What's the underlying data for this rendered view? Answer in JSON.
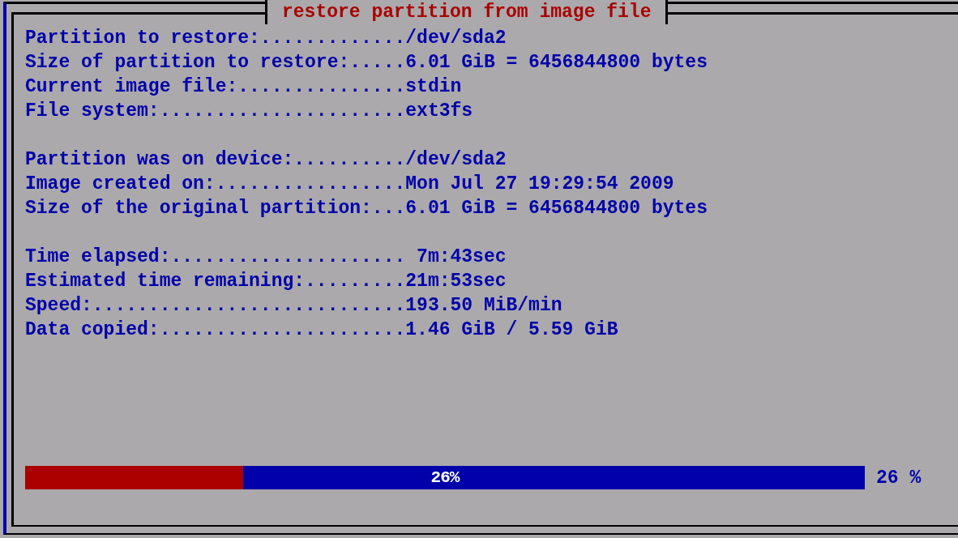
{
  "window": {
    "title": "restore partition from image file"
  },
  "sections": [
    {
      "lines": [
        "Partition to restore:............./dev/sda2",
        "Size of partition to restore:.....6.01 GiB = 6456844800 bytes",
        "Current image file:...............stdin",
        "File system:......................ext3fs"
      ]
    },
    {
      "lines": [
        "Partition was on device:........../dev/sda2",
        "Image created on:.................Mon Jul 27 19:29:54 2009",
        "Size of the original partition:...6.01 GiB = 6456844800 bytes"
      ]
    },
    {
      "lines": [
        "Time elapsed:..................... 7m:43sec",
        "Estimated time remaining:.........21m:53sec",
        "Speed:............................193.50 MiB/min",
        "Data copied:......................1.46 GiB / 5.59 GiB"
      ]
    }
  ],
  "progress": {
    "level": 0.26,
    "bar_label": "26%",
    "reading": "26 %"
  }
}
